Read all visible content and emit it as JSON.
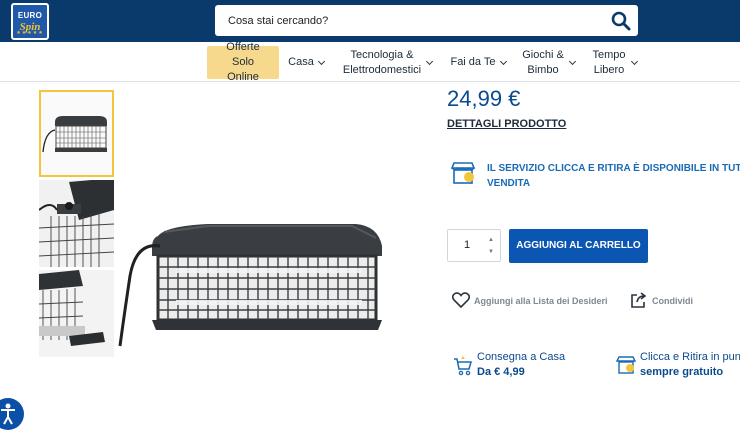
{
  "header": {
    "logo_line1": "EURO",
    "logo_line2": "Spin",
    "search_placeholder": "Cosa stai cercando?"
  },
  "nav": {
    "items": [
      {
        "label": "Offerte Solo Online",
        "dropdown": false
      },
      {
        "label": "Casa",
        "dropdown": true
      },
      {
        "label": "Tecnologia & Elettrodomestici",
        "dropdown": true
      },
      {
        "label": "Fai da Te",
        "dropdown": true
      },
      {
        "label": "Giochi & Bimbo",
        "dropdown": true
      },
      {
        "label": "Tempo Libero",
        "dropdown": true
      }
    ]
  },
  "product": {
    "price": "24,99 €",
    "details_link": "DETTAGLI PRODOTTO",
    "click_ritira_line1": "IL SERVIZIO CLICCA E RITIRA  È DISPONIBILE  IN TUTTI I P",
    "click_ritira_line2": "VENDITA",
    "quantity": "1",
    "add_to_cart": "AGGIUNGI AL CARRELLO",
    "wishlist": "Aggiungi alla Lista dei Desideri",
    "share": "Condividi"
  },
  "delivery": {
    "home_title": "Consegna a Casa",
    "home_price": "Da € 4,99",
    "pickup_title": "Clicca e Ritira in pun",
    "pickup_price": "sempre gratuito"
  },
  "colors": {
    "header_bg": "#0a3a6b",
    "accent_blue": "#0c56b3",
    "offer_bg": "#f6d98c",
    "thumb_active_border": "#f3c53a"
  },
  "icons": [
    "search-icon",
    "chevron-down-icon",
    "click-ritira-store-icon",
    "heart-icon",
    "share-icon",
    "delivery-cart-icon",
    "pickup-store-icon",
    "accessibility-icon"
  ]
}
